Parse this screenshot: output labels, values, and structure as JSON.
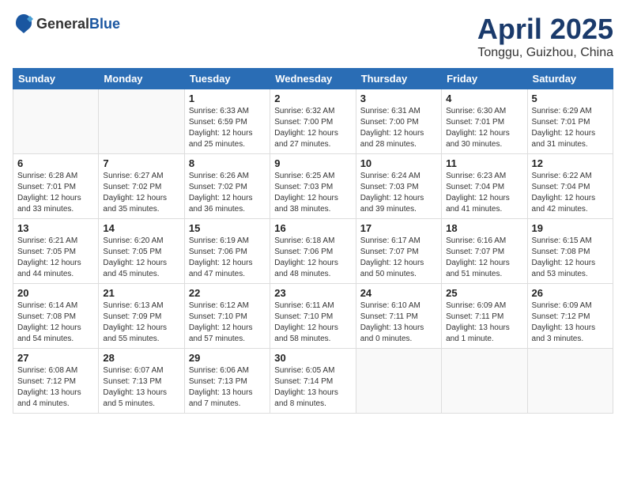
{
  "header": {
    "logo_general": "General",
    "logo_blue": "Blue",
    "month": "April 2025",
    "location": "Tonggu, Guizhou, China"
  },
  "days_of_week": [
    "Sunday",
    "Monday",
    "Tuesday",
    "Wednesday",
    "Thursday",
    "Friday",
    "Saturday"
  ],
  "weeks": [
    [
      {
        "day": "",
        "info": ""
      },
      {
        "day": "",
        "info": ""
      },
      {
        "day": "1",
        "info": "Sunrise: 6:33 AM\nSunset: 6:59 PM\nDaylight: 12 hours\nand 25 minutes."
      },
      {
        "day": "2",
        "info": "Sunrise: 6:32 AM\nSunset: 7:00 PM\nDaylight: 12 hours\nand 27 minutes."
      },
      {
        "day": "3",
        "info": "Sunrise: 6:31 AM\nSunset: 7:00 PM\nDaylight: 12 hours\nand 28 minutes."
      },
      {
        "day": "4",
        "info": "Sunrise: 6:30 AM\nSunset: 7:01 PM\nDaylight: 12 hours\nand 30 minutes."
      },
      {
        "day": "5",
        "info": "Sunrise: 6:29 AM\nSunset: 7:01 PM\nDaylight: 12 hours\nand 31 minutes."
      }
    ],
    [
      {
        "day": "6",
        "info": "Sunrise: 6:28 AM\nSunset: 7:01 PM\nDaylight: 12 hours\nand 33 minutes."
      },
      {
        "day": "7",
        "info": "Sunrise: 6:27 AM\nSunset: 7:02 PM\nDaylight: 12 hours\nand 35 minutes."
      },
      {
        "day": "8",
        "info": "Sunrise: 6:26 AM\nSunset: 7:02 PM\nDaylight: 12 hours\nand 36 minutes."
      },
      {
        "day": "9",
        "info": "Sunrise: 6:25 AM\nSunset: 7:03 PM\nDaylight: 12 hours\nand 38 minutes."
      },
      {
        "day": "10",
        "info": "Sunrise: 6:24 AM\nSunset: 7:03 PM\nDaylight: 12 hours\nand 39 minutes."
      },
      {
        "day": "11",
        "info": "Sunrise: 6:23 AM\nSunset: 7:04 PM\nDaylight: 12 hours\nand 41 minutes."
      },
      {
        "day": "12",
        "info": "Sunrise: 6:22 AM\nSunset: 7:04 PM\nDaylight: 12 hours\nand 42 minutes."
      }
    ],
    [
      {
        "day": "13",
        "info": "Sunrise: 6:21 AM\nSunset: 7:05 PM\nDaylight: 12 hours\nand 44 minutes."
      },
      {
        "day": "14",
        "info": "Sunrise: 6:20 AM\nSunset: 7:05 PM\nDaylight: 12 hours\nand 45 minutes."
      },
      {
        "day": "15",
        "info": "Sunrise: 6:19 AM\nSunset: 7:06 PM\nDaylight: 12 hours\nand 47 minutes."
      },
      {
        "day": "16",
        "info": "Sunrise: 6:18 AM\nSunset: 7:06 PM\nDaylight: 12 hours\nand 48 minutes."
      },
      {
        "day": "17",
        "info": "Sunrise: 6:17 AM\nSunset: 7:07 PM\nDaylight: 12 hours\nand 50 minutes."
      },
      {
        "day": "18",
        "info": "Sunrise: 6:16 AM\nSunset: 7:07 PM\nDaylight: 12 hours\nand 51 minutes."
      },
      {
        "day": "19",
        "info": "Sunrise: 6:15 AM\nSunset: 7:08 PM\nDaylight: 12 hours\nand 53 minutes."
      }
    ],
    [
      {
        "day": "20",
        "info": "Sunrise: 6:14 AM\nSunset: 7:08 PM\nDaylight: 12 hours\nand 54 minutes."
      },
      {
        "day": "21",
        "info": "Sunrise: 6:13 AM\nSunset: 7:09 PM\nDaylight: 12 hours\nand 55 minutes."
      },
      {
        "day": "22",
        "info": "Sunrise: 6:12 AM\nSunset: 7:10 PM\nDaylight: 12 hours\nand 57 minutes."
      },
      {
        "day": "23",
        "info": "Sunrise: 6:11 AM\nSunset: 7:10 PM\nDaylight: 12 hours\nand 58 minutes."
      },
      {
        "day": "24",
        "info": "Sunrise: 6:10 AM\nSunset: 7:11 PM\nDaylight: 13 hours\nand 0 minutes."
      },
      {
        "day": "25",
        "info": "Sunrise: 6:09 AM\nSunset: 7:11 PM\nDaylight: 13 hours\nand 1 minute."
      },
      {
        "day": "26",
        "info": "Sunrise: 6:09 AM\nSunset: 7:12 PM\nDaylight: 13 hours\nand 3 minutes."
      }
    ],
    [
      {
        "day": "27",
        "info": "Sunrise: 6:08 AM\nSunset: 7:12 PM\nDaylight: 13 hours\nand 4 minutes."
      },
      {
        "day": "28",
        "info": "Sunrise: 6:07 AM\nSunset: 7:13 PM\nDaylight: 13 hours\nand 5 minutes."
      },
      {
        "day": "29",
        "info": "Sunrise: 6:06 AM\nSunset: 7:13 PM\nDaylight: 13 hours\nand 7 minutes."
      },
      {
        "day": "30",
        "info": "Sunrise: 6:05 AM\nSunset: 7:14 PM\nDaylight: 13 hours\nand 8 minutes."
      },
      {
        "day": "",
        "info": ""
      },
      {
        "day": "",
        "info": ""
      },
      {
        "day": "",
        "info": ""
      }
    ]
  ]
}
